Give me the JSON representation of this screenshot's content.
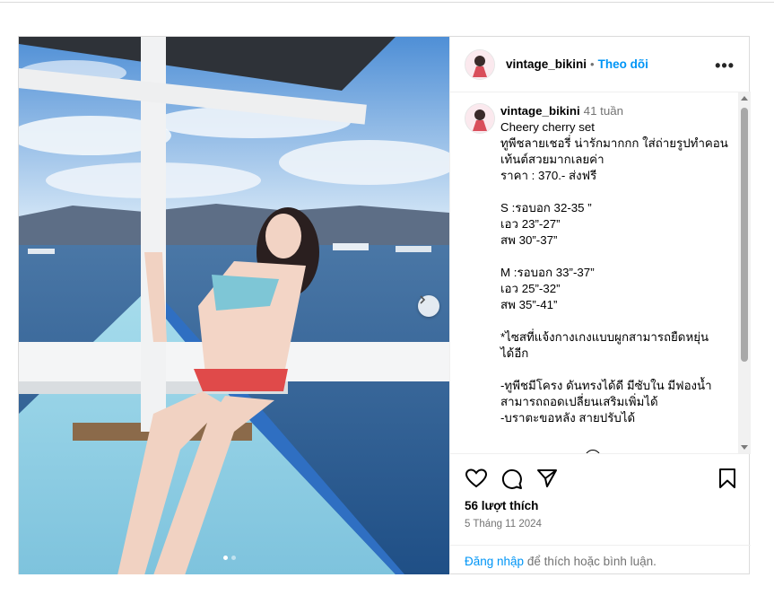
{
  "post": {
    "username": "vintage_bikini",
    "follow_label": "Theo dõi",
    "separator": "•",
    "more_label": "•••",
    "caption": {
      "time": "41 tuần",
      "lines": [
        "Cheery cherry set",
        "ทูพีชลายเชอรี่ น่ารักมากกก ใส่ถ่ายรูปทำคอน",
        "เท้นต์สวยมากเลยค่า",
        "ราคา : 370.- ส่งฟรี",
        "",
        "S :รอบอก 32-35 ”",
        "เอว 23”-27”",
        "สพ 30”-37”",
        "",
        "M :รอบอก 33”-37”",
        "เอว 25”-32”",
        "สพ 35”-41”",
        "",
        "*ไซสที่แจ้งกางเกงแบบผูกสามารถยืดหยุ่น",
        "ได้อีก",
        "",
        "-ทูพีชมีโครง ดันทรงได้ดี มีซับใน มีฟองน้ำ",
        "สามารถถอดเปลี่ยนเสริมเพิ่มได้",
        "-บราตะขอหลัง สายปรับได้"
      ]
    },
    "likes": "56 lượt thích",
    "date": "5 Tháng 11 2024",
    "login_link": "Đăng nhập",
    "login_rest": " để thích hoặc bình luận."
  },
  "icons": {
    "like": "heart-icon",
    "comment": "comment-icon",
    "share": "send-icon",
    "save": "bookmark-icon",
    "next": "chevron-right-icon"
  },
  "colors": {
    "link": "#0095f6",
    "muted": "#737373",
    "border": "#dbdbdb"
  }
}
